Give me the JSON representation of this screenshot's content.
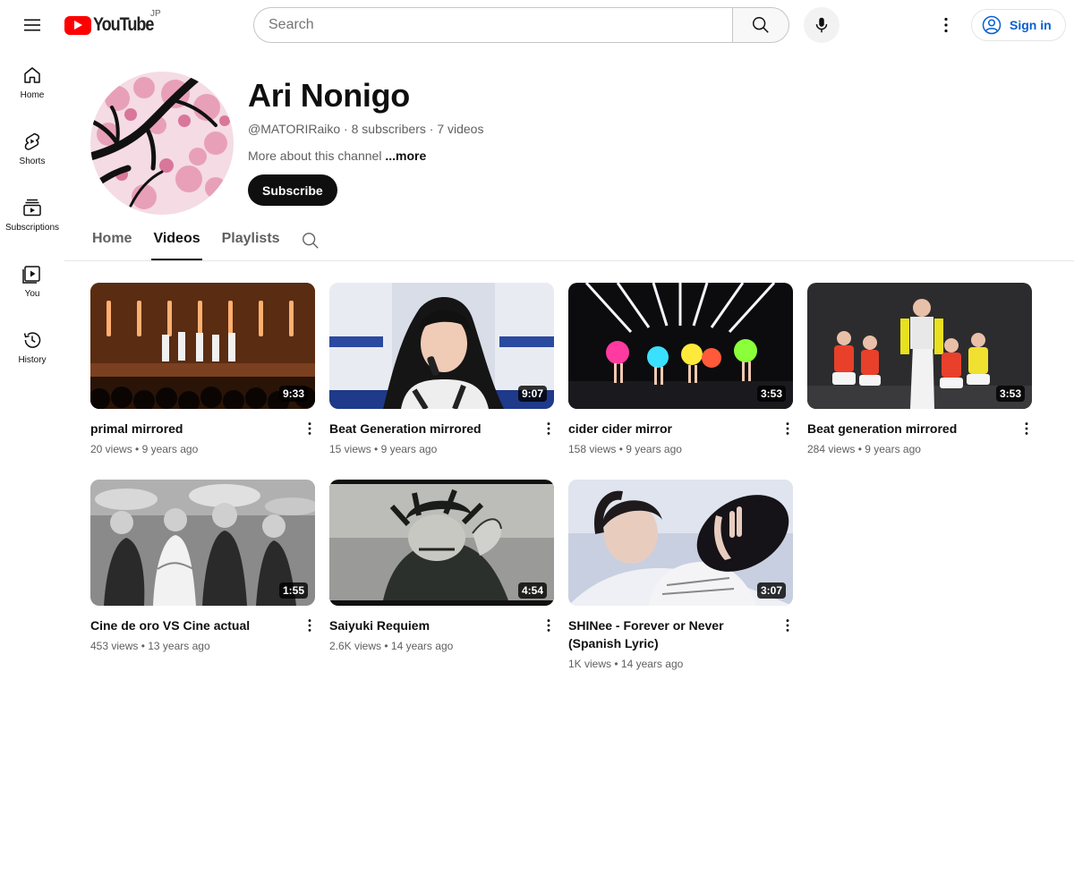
{
  "header": {
    "brand": "YouTube",
    "region": "JP",
    "search_placeholder": "Search",
    "sign_in_label": "Sign in"
  },
  "sidebar": {
    "items": [
      {
        "label": "Home",
        "icon": "home-icon"
      },
      {
        "label": "Shorts",
        "icon": "shorts-icon"
      },
      {
        "label": "Subscriptions",
        "icon": "subscriptions-icon"
      },
      {
        "label": "You",
        "icon": "you-icon"
      },
      {
        "label": "History",
        "icon": "history-icon"
      }
    ]
  },
  "channel": {
    "name": "Ari Nonigo",
    "handle": "@MATORIRaiko",
    "subscribers": "8 subscribers",
    "videos_count": "7 videos",
    "separator": " · ",
    "description": "More about this channel",
    "more_label": "...more",
    "subscribe_label": "Subscribe"
  },
  "tabs": [
    {
      "label": "Home",
      "active": false
    },
    {
      "label": "Videos",
      "active": true
    },
    {
      "label": "Playlists",
      "active": false
    }
  ],
  "videos": [
    {
      "title": "primal mirrored",
      "views": "20 views",
      "age": "9 years ago",
      "duration": "9:33"
    },
    {
      "title": "Beat Generation mirrored",
      "views": "15 views",
      "age": "9 years ago",
      "duration": "9:07"
    },
    {
      "title": "cider cider mirror",
      "views": "158 views",
      "age": "9 years ago",
      "duration": "3:53"
    },
    {
      "title": "Beat generation mirrored",
      "views": "284 views",
      "age": "9 years ago",
      "duration": "3:53"
    },
    {
      "title": "Cine de oro VS Cine actual",
      "views": "453 views",
      "age": "13 years ago",
      "duration": "1:55"
    },
    {
      "title": "Saiyuki Requiem",
      "views": "2.6K views",
      "age": "14 years ago",
      "duration": "4:54"
    },
    {
      "title": "SHINee - Forever or Never (Spanish Lyric)",
      "views": "1K views",
      "age": "14 years ago",
      "duration": "3:07"
    }
  ],
  "colors": {
    "brand_red": "#ff0000",
    "link_blue": "#065fd4",
    "text_primary": "#0f0f0f",
    "text_secondary": "#606060"
  }
}
